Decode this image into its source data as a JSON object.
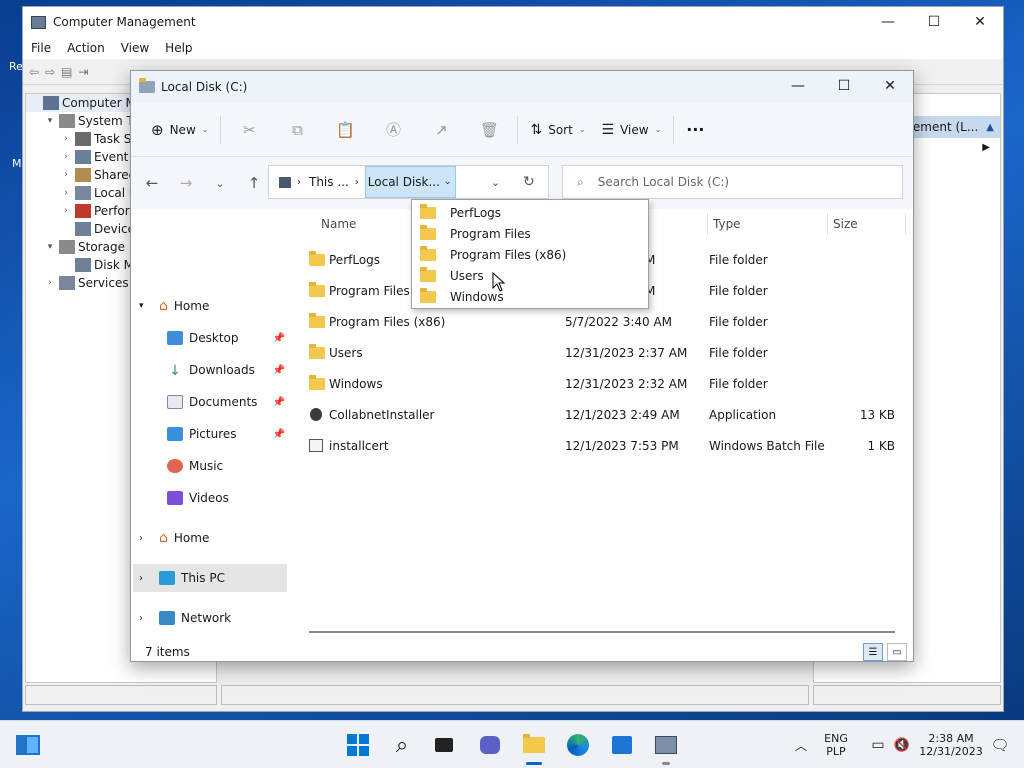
{
  "desktop": {
    "icon1_label": "Re",
    "icon2_label": "M"
  },
  "computer_management": {
    "title": "Computer Management",
    "menu": [
      "File",
      "Action",
      "View",
      "Help"
    ],
    "tree": [
      {
        "label": "Computer Mar",
        "level": 0,
        "twisty": ""
      },
      {
        "label": "System Too",
        "level": 1,
        "twisty": "▾"
      },
      {
        "label": "Task Sch",
        "level": 2,
        "twisty": "›"
      },
      {
        "label": "Event Vi",
        "level": 2,
        "twisty": "›"
      },
      {
        "label": "Shared I",
        "level": 2,
        "twisty": "›"
      },
      {
        "label": "Local Us",
        "level": 2,
        "twisty": "›"
      },
      {
        "label": "Perform",
        "level": 2,
        "twisty": "›"
      },
      {
        "label": "Device I",
        "level": 2,
        "twisty": ""
      },
      {
        "label": "Storage",
        "level": 1,
        "twisty": "▾"
      },
      {
        "label": "Disk Ma",
        "level": 2,
        "twisty": ""
      },
      {
        "label": "Services an",
        "level": 1,
        "twisty": "›"
      }
    ],
    "actions_header": "ement (L..."
  },
  "explorer": {
    "title": "Local Disk (C:)",
    "commands": {
      "new": "New",
      "sort": "Sort",
      "view": "View",
      "more": "···"
    },
    "breadcrumb": {
      "this_pc": "This ...",
      "current": "Local Disk..."
    },
    "search_placeholder": "Search Local Disk (C:)",
    "sidebar": {
      "home": "Home",
      "desktop": "Desktop",
      "downloads": "Downloads",
      "documents": "Documents",
      "pictures": "Pictures",
      "music": "Music",
      "videos": "Videos",
      "home2": "Home",
      "this_pc": "This PC",
      "network": "Network"
    },
    "columns": {
      "name": "Name",
      "type": "Type",
      "size": "Size"
    },
    "files": [
      {
        "name": "PerfLogs",
        "date": "M",
        "type": "File folder",
        "size": ""
      },
      {
        "name": "Program Files",
        "date": "M",
        "type": "File folder",
        "size": ""
      },
      {
        "name": "Program Files (x86)",
        "date": "5/7/2022 3:40 AM",
        "type": "File folder",
        "size": ""
      },
      {
        "name": "Users",
        "date": "12/31/2023 2:37 AM",
        "type": "File folder",
        "size": ""
      },
      {
        "name": "Windows",
        "date": "12/31/2023 2:32 AM",
        "type": "File folder",
        "size": ""
      },
      {
        "name": "CollabnetInstaller",
        "date": "12/1/2023 2:49 AM",
        "type": "Application",
        "size": "13 KB"
      },
      {
        "name": "installcert",
        "date": "12/1/2023 7:53 PM",
        "type": "Windows Batch File",
        "size": "1 KB"
      }
    ],
    "status": "7 items",
    "dropdown": [
      "PerfLogs",
      "Program Files",
      "Program Files (x86)",
      "Users",
      "Windows"
    ]
  },
  "taskbar": {
    "lang_top": "ENG",
    "lang_bottom": "PLP",
    "time": "2:38 AM",
    "date": "12/31/2023"
  },
  "colors": {
    "accent": "#0067c0",
    "folder": "#f2c94c",
    "selection": "#cce4f7"
  }
}
